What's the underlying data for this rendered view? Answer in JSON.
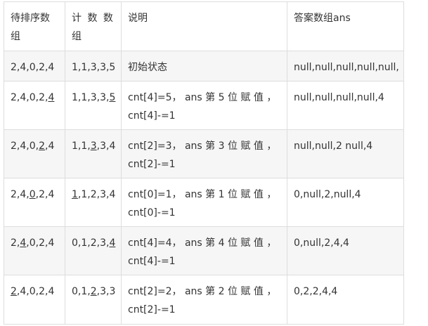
{
  "headers": [
    "待排序数组",
    "计 数 数组",
    "说明",
    "答案数组ans"
  ],
  "rows": [
    {
      "arr": {
        "before": "2,4,0,2,4",
        "u": "",
        "after": ""
      },
      "cnt": {
        "before": "1,1,3,3,5",
        "u": "",
        "after": ""
      },
      "desc": [
        "初始状态"
      ],
      "ans": "null,null,null,null,null,"
    },
    {
      "arr": {
        "before": "2,4,0,2,",
        "u": "4",
        "after": ""
      },
      "cnt": {
        "before": "1,1,3,3,",
        "u": "5",
        "after": ""
      },
      "desc": [
        "cnt[4]=5， ans 第 5 位 赋 值 ，",
        "cnt[4]-=1"
      ],
      "ans": "null,null,null,null,4"
    },
    {
      "arr": {
        "before": "2,4,0,",
        "u": "2",
        "after": ",4"
      },
      "cnt": {
        "before": "1,1,",
        "u": "3",
        "after": ",3,4"
      },
      "desc": [
        "cnt[2]=3， ans 第 3 位 赋 值 ，",
        "cnt[2]-=1"
      ],
      "ans": "null,null,2 null,4"
    },
    {
      "arr": {
        "before": "2,4,",
        "u": "0",
        "after": ",2,4"
      },
      "cnt": {
        "before": "",
        "u": "1",
        "after": ",1,2,3,4"
      },
      "desc": [
        "cnt[0]=1， ans 第 1 位 赋 值 ，",
        "cnt[0]-=1"
      ],
      "ans": "0,null,2,null,4"
    },
    {
      "arr": {
        "before": "2,",
        "u": "4",
        "after": ",0,2,4"
      },
      "cnt": {
        "before": "0,1,2,3,",
        "u": "4",
        "after": ""
      },
      "desc": [
        "cnt[4]=4， ans 第 4 位 赋 值 ，",
        "cnt[4]-=1"
      ],
      "ans": "0,null,2,4,4"
    },
    {
      "arr": {
        "before": "",
        "u": "2",
        "after": ",4,0,2,4"
      },
      "cnt": {
        "before": "0,1,",
        "u": "2",
        "after": ",3,3"
      },
      "desc": [
        "cnt[2]=2， ans 第 2 位 赋 值 ，",
        "cnt[2]-=1"
      ],
      "ans": "0,2,2,4,4"
    }
  ]
}
